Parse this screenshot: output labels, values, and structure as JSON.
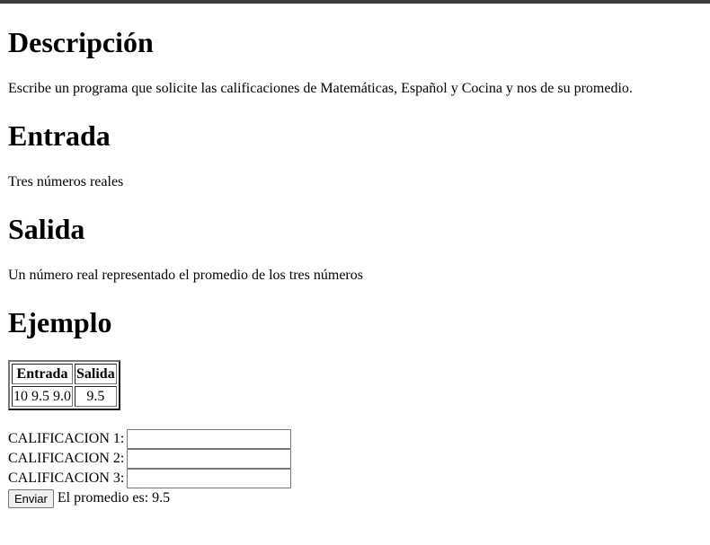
{
  "sections": {
    "description": {
      "heading": "Descripción",
      "text": "Escribe un programa que solicite las calificaciones de Matemáticas, Español y Cocina y nos de su promedio."
    },
    "input": {
      "heading": "Entrada",
      "text": "Tres números reales"
    },
    "output": {
      "heading": "Salida",
      "text": "Un número real representado el promedio de los tres números"
    },
    "example": {
      "heading": "Ejemplo",
      "table": {
        "headers": [
          "Entrada",
          "Salida"
        ],
        "rows": [
          [
            "10 9.5 9.0",
            "9.5"
          ]
        ]
      }
    }
  },
  "form": {
    "fields": [
      {
        "label": "CALIFICACION 1:",
        "value": ""
      },
      {
        "label": "CALIFICACION 2:",
        "value": ""
      },
      {
        "label": "CALIFICACION 3:",
        "value": ""
      }
    ],
    "submit_label": "Enviar",
    "result_text": "El promedio es: 9.5"
  }
}
